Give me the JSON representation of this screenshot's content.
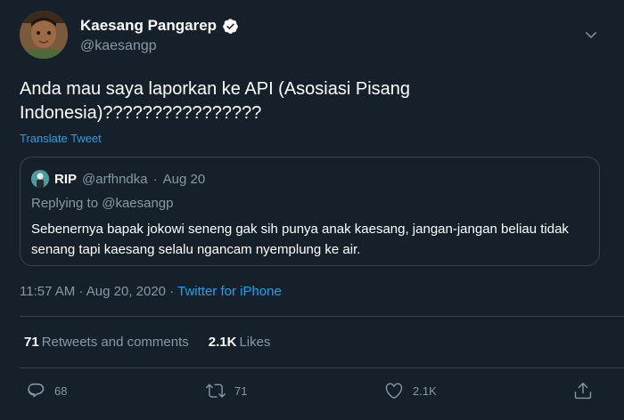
{
  "author": {
    "name": "Kaesang Pangarep",
    "handle": "@kaesangp"
  },
  "tweet": {
    "text": "Anda mau saya laporkan ke API (Asosiasi Pisang Indonesia)????????????????",
    "translate_label": "Translate Tweet"
  },
  "quoted": {
    "name": "RIP",
    "handle": "@arfhndka",
    "separator": "·",
    "date": "Aug 20",
    "replying_to": "Replying to @kaesangp",
    "text": "Sebenernya bapak jokowi seneng gak sih punya anak kaesang, jangan-jangan beliau tidak senang tapi kaesang selalu ngancam nyemplung ke air."
  },
  "meta": {
    "time": "11:57 AM",
    "sep1": "·",
    "date": "Aug 20, 2020",
    "sep2": "·",
    "source": "Twitter for iPhone"
  },
  "stats": {
    "retweets_count": "71",
    "retweets_label": "Retweets and comments",
    "likes_count": "2.1K",
    "likes_label": "Likes"
  },
  "actions": {
    "reply_count": "68",
    "retweet_count": "71",
    "like_count": "2.1K"
  },
  "colors": {
    "background": "#15202b",
    "text_secondary": "#8899a6",
    "accent": "#1da1f2",
    "border": "#38444d"
  },
  "icons": [
    "verified-badge-icon",
    "chevron-down-icon",
    "reply-icon",
    "retweet-icon",
    "like-icon",
    "share-icon"
  ]
}
